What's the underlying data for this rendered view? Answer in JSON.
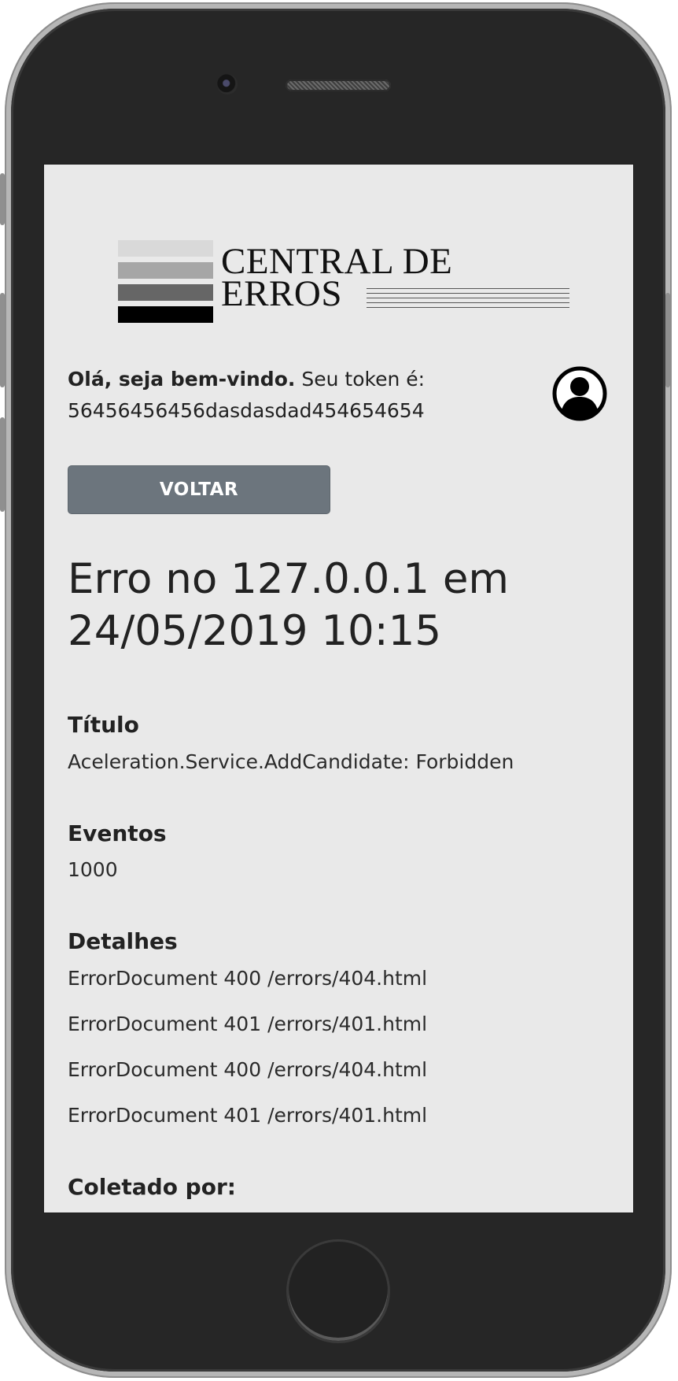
{
  "logo": {
    "line1": "CENTRAL DE",
    "line2": "ERROS",
    "bar_colors": [
      "#d9d9d9",
      "#a6a6a6",
      "#666666",
      "#000000"
    ]
  },
  "welcome": {
    "greeting_bold": "Olá, seja bem-vindo.",
    "token_label": "Seu token é:",
    "token": "56456456456dasdasdad454654654"
  },
  "avatar_icon": "user-circle-icon",
  "back_button": {
    "label": "VOLTAR",
    "color": "#6c757d"
  },
  "error": {
    "heading_line1": "Erro no 127.0.0.1 em",
    "heading_line2": "24/05/2019 10:15",
    "title_label": "Título",
    "title_value": "Aceleration.Service.AddCandidate: Forbidden",
    "events_label": "Eventos",
    "events_value": "1000",
    "details_label": "Detalhes",
    "details": [
      "ErrorDocument 400 /errors/404.html",
      "ErrorDocument 401 /errors/401.html",
      "ErrorDocument 400 /errors/404.html",
      "ErrorDocument 401 /errors/401.html"
    ],
    "collected_label": "Coletado por:"
  }
}
